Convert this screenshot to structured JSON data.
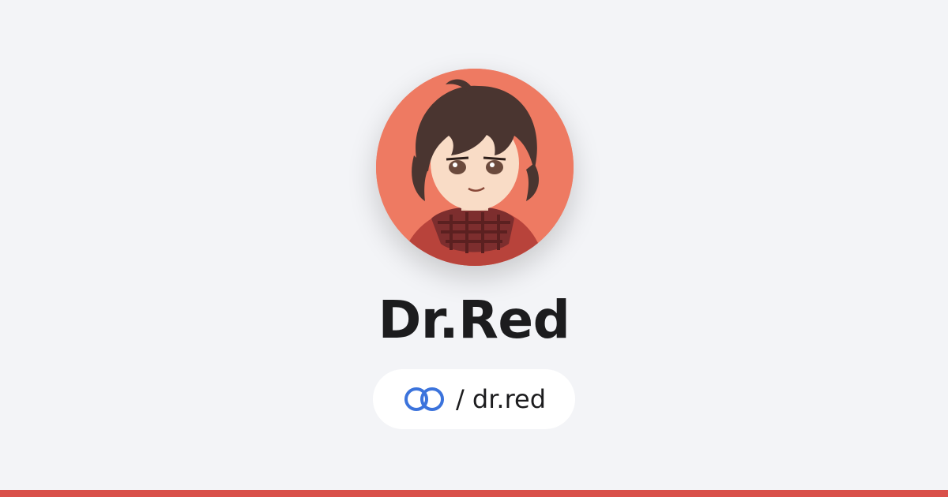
{
  "profile": {
    "display_name": "Dr.Red",
    "handle": "/ dr.red",
    "avatar_icon": "avatar-illustration"
  },
  "brand": {
    "logo_icon": "interlocked-rings-icon",
    "logo_color": "#3b73dc",
    "accent_color": "#d9504a",
    "avatar_background": "#ee7a62",
    "page_background": "#f3f4f7"
  }
}
